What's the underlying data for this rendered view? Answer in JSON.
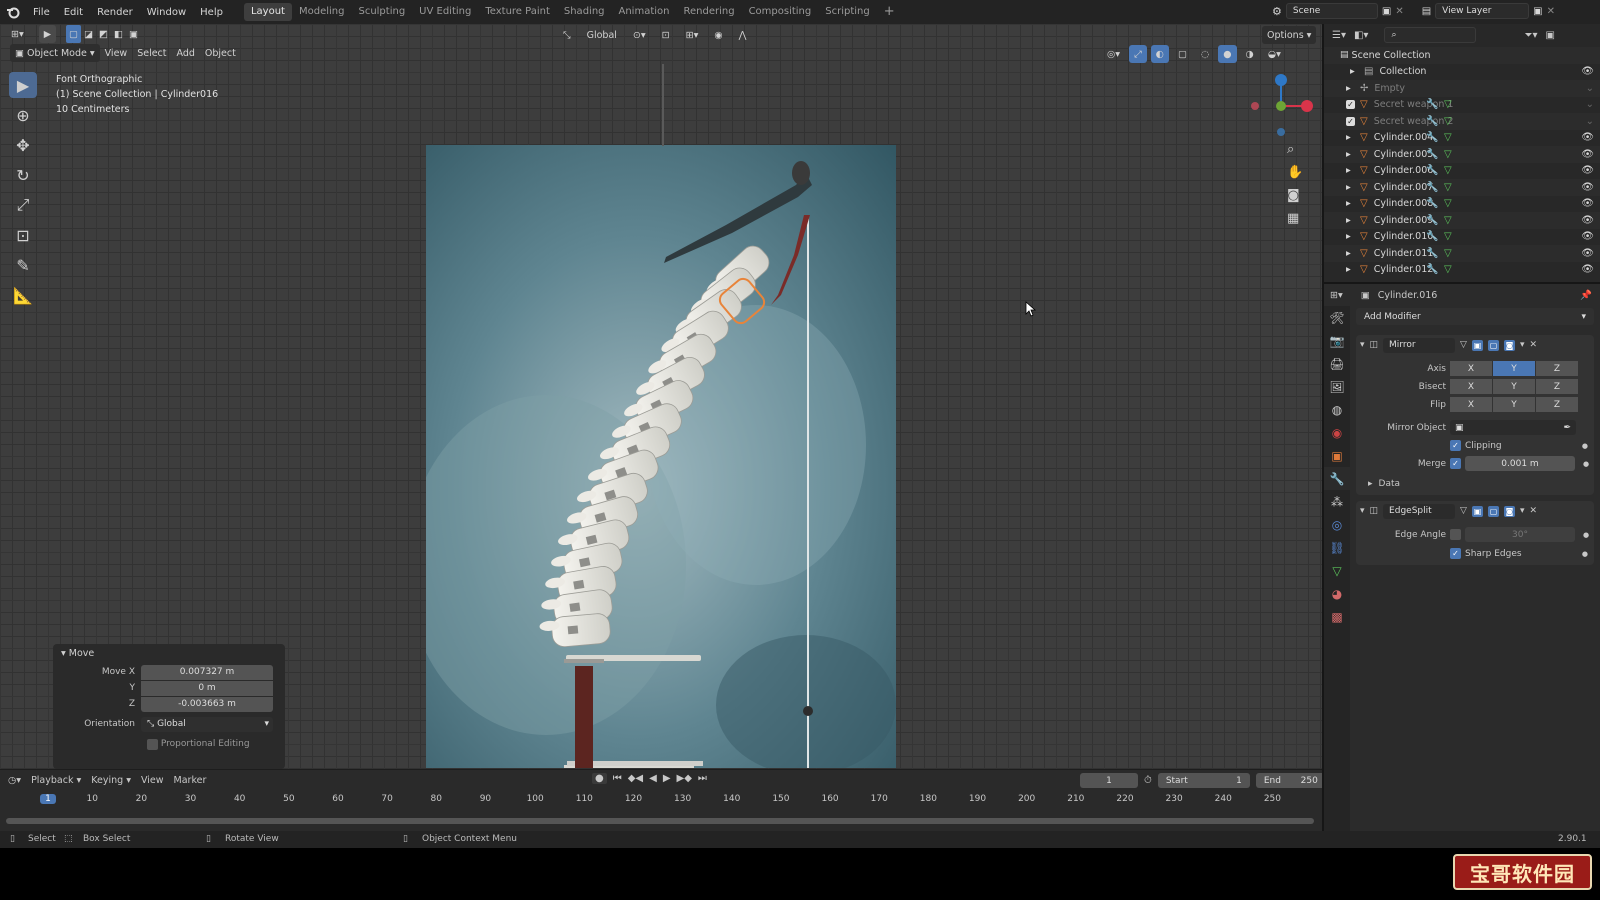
{
  "menus": [
    "File",
    "Edit",
    "Render",
    "Window",
    "Help"
  ],
  "workspaces": [
    "Layout",
    "Modeling",
    "Sculpting",
    "UV Editing",
    "Texture Paint",
    "Shading",
    "Animation",
    "Rendering",
    "Compositing",
    "Scripting"
  ],
  "active_workspace": "Layout",
  "scene": {
    "label": "Scene",
    "view_layer": "View Layer"
  },
  "header": {
    "mode": "Object Mode",
    "menu": [
      "View",
      "Select",
      "Add",
      "Object"
    ],
    "orientation": "Global",
    "options": "Options"
  },
  "overlay_text": {
    "view": "Font Orthographic",
    "collection": "(1) Scene Collection | Cylinder016",
    "scale": "10 Centimeters"
  },
  "move_panel": {
    "title": "Move",
    "move_x_label": "Move X",
    "move_x": "0.007327 m",
    "y_label": "Y",
    "y": "0 m",
    "z_label": "Z",
    "z": "-0.003663 m",
    "orientation_label": "Orientation",
    "orientation": "Global",
    "proportional": "Proportional Editing"
  },
  "outliner": {
    "root": "Scene Collection",
    "items": [
      {
        "name": "Collection",
        "dim": false,
        "kind": "collection"
      },
      {
        "name": "Empty",
        "dim": true,
        "kind": "empty"
      },
      {
        "name": "Secret weapon 1",
        "dim": true,
        "kind": "mesh"
      },
      {
        "name": "Secret weapon 2",
        "dim": true,
        "kind": "mesh"
      },
      {
        "name": "Cylinder.004",
        "dim": false,
        "kind": "mesh"
      },
      {
        "name": "Cylinder.005",
        "dim": false,
        "kind": "mesh"
      },
      {
        "name": "Cylinder.006",
        "dim": false,
        "kind": "mesh"
      },
      {
        "name": "Cylinder.007",
        "dim": false,
        "kind": "mesh"
      },
      {
        "name": "Cylinder.008",
        "dim": false,
        "kind": "mesh"
      },
      {
        "name": "Cylinder.009",
        "dim": false,
        "kind": "mesh"
      },
      {
        "name": "Cylinder.010",
        "dim": false,
        "kind": "mesh"
      },
      {
        "name": "Cylinder.011",
        "dim": false,
        "kind": "mesh"
      },
      {
        "name": "Cylinder.012",
        "dim": false,
        "kind": "mesh"
      }
    ]
  },
  "properties": {
    "object": "Cylinder.016",
    "add_modifier": "Add Modifier",
    "mirror": {
      "name": "Mirror",
      "axis_label": "Axis",
      "bisect_label": "Bisect",
      "flip_label": "Flip",
      "axes": [
        "X",
        "Y",
        "Z"
      ],
      "mirror_object_label": "Mirror Object",
      "clipping": "Clipping",
      "merge_label": "Merge",
      "merge_value": "0.001 m",
      "data": "Data"
    },
    "edgesplit": {
      "name": "EdgeSplit",
      "edge_angle_label": "Edge Angle",
      "edge_angle_value": "30°",
      "sharp_edges": "Sharp Edges"
    }
  },
  "timeline": {
    "menus": [
      "Playback",
      "Keying",
      "View",
      "Marker"
    ],
    "current_frame": "1",
    "start_label": "Start",
    "start": "1",
    "end_label": "End",
    "end": "250",
    "ticks": [
      "1",
      "10",
      "20",
      "30",
      "40",
      "50",
      "60",
      "70",
      "80",
      "90",
      "100",
      "110",
      "120",
      "130",
      "140",
      "150",
      "160",
      "170",
      "180",
      "190",
      "200",
      "210",
      "220",
      "230",
      "240",
      "250"
    ]
  },
  "status": {
    "select": "Select",
    "box_select": "Box Select",
    "rotate": "Rotate View",
    "context": "Object Context Menu",
    "version": "2.90.1"
  },
  "watermark": "宝哥软件园",
  "colors": {
    "accent": "#4a77b4",
    "selected_outline": "#e8843a",
    "panel": "#2b2b2b",
    "viewport": "#3d3d3d"
  }
}
